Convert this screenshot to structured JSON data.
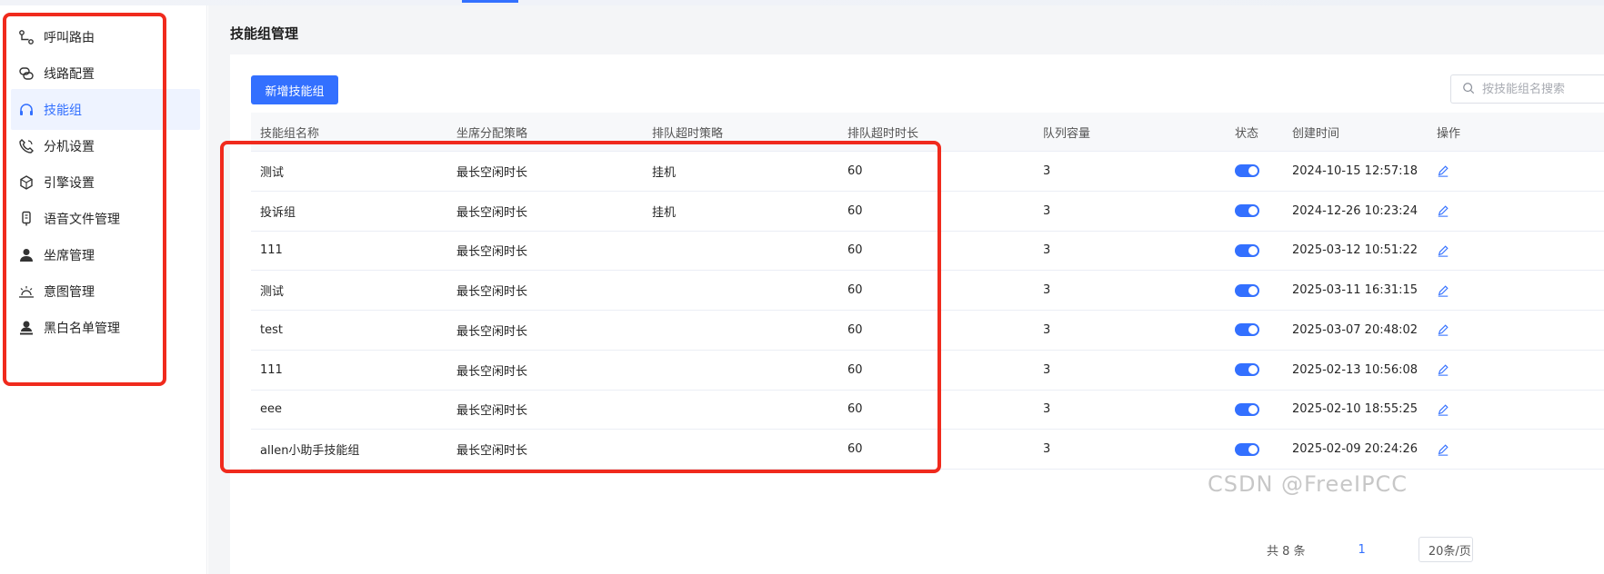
{
  "colors": {
    "accent": "#3370ff",
    "highlight_box": "#f02a1d"
  },
  "sidebar": {
    "items": [
      {
        "label": "呼叫路由",
        "icon": "route-icon",
        "active": false
      },
      {
        "label": "线路配置",
        "icon": "line-config-icon",
        "active": false
      },
      {
        "label": "技能组",
        "icon": "headset-icon",
        "active": true
      },
      {
        "label": "分机设置",
        "icon": "phone-icon",
        "active": false
      },
      {
        "label": "引擎设置",
        "icon": "engine-icon",
        "active": false
      },
      {
        "label": "语音文件管理",
        "icon": "voice-file-icon",
        "active": false
      },
      {
        "label": "坐席管理",
        "icon": "agent-icon",
        "active": false
      },
      {
        "label": "意图管理",
        "icon": "intent-icon",
        "active": false
      },
      {
        "label": "黑白名单管理",
        "icon": "blacklist-icon",
        "active": false
      }
    ]
  },
  "page": {
    "title": "技能组管理"
  },
  "toolbar": {
    "add_label": "新增技能组",
    "search_placeholder": "按技能组名搜索"
  },
  "table": {
    "columns": [
      "技能组名称",
      "坐席分配策略",
      "排队超时策略",
      "排队超时时长",
      "队列容量",
      "状态",
      "创建时间",
      "操作"
    ],
    "rows": [
      {
        "name": "测试",
        "strategy": "最长空闲时长",
        "timeout_strategy": "挂机",
        "timeout": "60",
        "capacity": "3",
        "enabled": true,
        "created": "2024-10-15 12:57:18"
      },
      {
        "name": "投诉组",
        "strategy": "最长空闲时长",
        "timeout_strategy": "挂机",
        "timeout": "60",
        "capacity": "3",
        "enabled": true,
        "created": "2024-12-26 10:23:24"
      },
      {
        "name": "111",
        "strategy": "最长空闲时长",
        "timeout_strategy": "",
        "timeout": "60",
        "capacity": "3",
        "enabled": true,
        "created": "2025-03-12 10:51:22"
      },
      {
        "name": "测试",
        "strategy": "最长空闲时长",
        "timeout_strategy": "",
        "timeout": "60",
        "capacity": "3",
        "enabled": true,
        "created": "2025-03-11 16:31:15"
      },
      {
        "name": "test",
        "strategy": "最长空闲时长",
        "timeout_strategy": "",
        "timeout": "60",
        "capacity": "3",
        "enabled": true,
        "created": "2025-03-07 20:48:02"
      },
      {
        "name": "111",
        "strategy": "最长空闲时长",
        "timeout_strategy": "",
        "timeout": "60",
        "capacity": "3",
        "enabled": true,
        "created": "2025-02-13 10:56:08"
      },
      {
        "name": "eee",
        "strategy": "最长空闲时长",
        "timeout_strategy": "",
        "timeout": "60",
        "capacity": "3",
        "enabled": true,
        "created": "2025-02-10 18:55:25"
      },
      {
        "name": "allen小助手技能组",
        "strategy": "最长空闲时长",
        "timeout_strategy": "",
        "timeout": "60",
        "capacity": "3",
        "enabled": true,
        "created": "2025-02-09 20:24:26"
      }
    ]
  },
  "pagination": {
    "total": "共 8 条",
    "current_page": "1",
    "page_size": "20条/页"
  },
  "watermark": "CSDN @FreeIPCC"
}
